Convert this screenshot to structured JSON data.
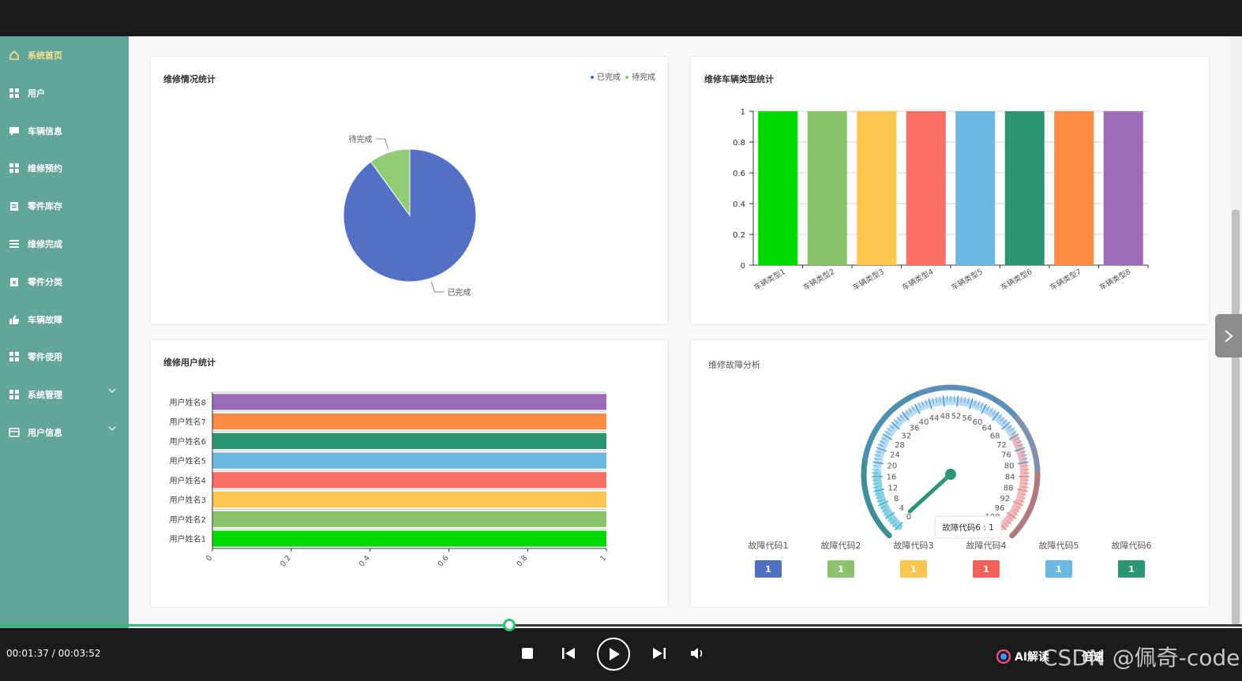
{
  "sidebar": {
    "items": [
      {
        "label": "系统首页",
        "icon": "home-icon"
      },
      {
        "label": "用户",
        "icon": "grid-icon"
      },
      {
        "label": "车辆信息",
        "icon": "chat-icon"
      },
      {
        "label": "维修预约",
        "icon": "grid-icon"
      },
      {
        "label": "零件库存",
        "icon": "clipboard-icon"
      },
      {
        "label": "维修完成",
        "icon": "list-icon"
      },
      {
        "label": "零件分类",
        "icon": "clipboard-x-icon"
      },
      {
        "label": "车辆故障",
        "icon": "thumb-icon"
      },
      {
        "label": "零件使用",
        "icon": "grid-icon"
      },
      {
        "label": "系统管理",
        "icon": "grid-icon"
      },
      {
        "label": "用户信息",
        "icon": "card-icon"
      }
    ]
  },
  "cards": {
    "repair_status": {
      "title": "维修情况统计"
    },
    "vehicle_type": {
      "title": "维修车辆类型统计"
    },
    "repair_user": {
      "title": "维修用户统计"
    },
    "fault": {
      "title": "维修故障分析"
    }
  },
  "chart_data": [
    {
      "type": "pie",
      "title": "维修情况统计",
      "categories": [
        "已完成",
        "待完成"
      ],
      "values": [
        9,
        1
      ],
      "legend": [
        "已完成",
        "待完成"
      ],
      "legend_position": "top-right",
      "colors": [
        "#5470c6",
        "#91cc75"
      ]
    },
    {
      "type": "bar",
      "title": "维修车辆类型统计",
      "categories": [
        "车辆类型1",
        "车辆类型2",
        "车辆类型3",
        "车辆类型4",
        "车辆类型5",
        "车辆类型6",
        "车辆类型7",
        "车辆类型8"
      ],
      "values": [
        1,
        1,
        1,
        1,
        1,
        1,
        1,
        1
      ],
      "ylim": [
        0,
        1
      ],
      "yticks": [
        "0",
        "0.2",
        "0.4",
        "0.6",
        "0.8",
        "1"
      ],
      "grid": true,
      "colors": [
        "#00d900",
        "#8bc36f",
        "#fec64f",
        "#fb6f66",
        "#6bb8e0",
        "#2e9571",
        "#fd8b46",
        "#9b6bb8"
      ]
    },
    {
      "type": "bar",
      "orientation": "horizontal",
      "title": "维修用户统计",
      "categories": [
        "用户姓名1",
        "用户姓名2",
        "用户姓名3",
        "用户姓名4",
        "用户姓名5",
        "用户姓名6",
        "用户姓名7",
        "用户姓名8"
      ],
      "values": [
        1,
        1,
        1,
        1,
        1,
        1,
        1,
        1
      ],
      "xlim": [
        0,
        1
      ],
      "xticks": [
        "0",
        "0.2",
        "0.4",
        "0.6",
        "0.8",
        "1"
      ],
      "colors": [
        "#00d900",
        "#8bc36f",
        "#fec64f",
        "#fb6f66",
        "#6bb8e0",
        "#2e9571",
        "#fd8b46",
        "#9b6bb8"
      ]
    },
    {
      "type": "gauge",
      "title": "维修故障分析",
      "min": 0,
      "max": 100,
      "tick_labels": [
        "0",
        "4",
        "8",
        "12",
        "16",
        "20",
        "24",
        "28",
        "32",
        "36",
        "40",
        "44",
        "48",
        "52",
        "56",
        "60",
        "64",
        "68",
        "72",
        "76",
        "80",
        "84",
        "88",
        "92",
        "96",
        "100"
      ],
      "value": 1,
      "tooltip": "故障代码6 : 1",
      "series": [
        {
          "name": "故障代码1",
          "value": 1,
          "color": "#4e6fc2"
        },
        {
          "name": "故障代码2",
          "value": 1,
          "color": "#8bc36f"
        },
        {
          "name": "故障代码3",
          "value": 1,
          "color": "#fec64f"
        },
        {
          "name": "故障代码4",
          "value": 1,
          "color": "#f2625a"
        },
        {
          "name": "故障代码5",
          "value": 1,
          "color": "#6bb8e0"
        },
        {
          "name": "故障代码6",
          "value": 1,
          "color": "#2e9571"
        }
      ]
    }
  ],
  "player": {
    "time": "00:01:37 / 00:03:52",
    "progress": 0.41,
    "ai_label": "AI解读",
    "speed_label": "倍速",
    "watermark": "CSDN @佩奇-code"
  }
}
